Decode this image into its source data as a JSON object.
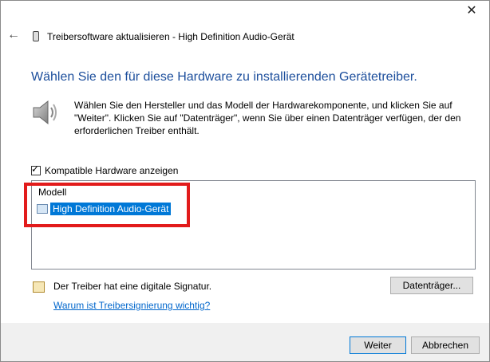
{
  "window": {
    "close_icon": "✕",
    "back_icon": "←",
    "title": "Treibersoftware aktualisieren - High Definition Audio-Gerät"
  },
  "main": {
    "heading": "Wählen Sie den für diese Hardware zu installierenden Gerätetreiber.",
    "description": "Wählen Sie den Hersteller und das Modell der Hardwarekomponente, und klicken Sie auf \"Weiter\". Klicken Sie auf \"Datenträger\", wenn Sie über einen Datenträger verfügen, der den erforderlichen Treiber enthält.",
    "compatible_checkbox_label": "Kompatible Hardware anzeigen",
    "compatible_checked": true,
    "list": {
      "header": "Modell",
      "items": [
        {
          "label": "High Definition Audio-Gerät",
          "selected": true
        }
      ]
    },
    "signature_text": "Der Treiber hat eine digitale Signatur.",
    "signature_link": "Warum ist Treibersignierung wichtig?",
    "disk_button": "Datenträger..."
  },
  "footer": {
    "next_button": "Weiter",
    "cancel_button": "Abbrechen"
  },
  "colors": {
    "heading": "#1c4e9c",
    "selection": "#0078d7",
    "highlight_box": "#e21b1b",
    "link": "#0066cc"
  }
}
